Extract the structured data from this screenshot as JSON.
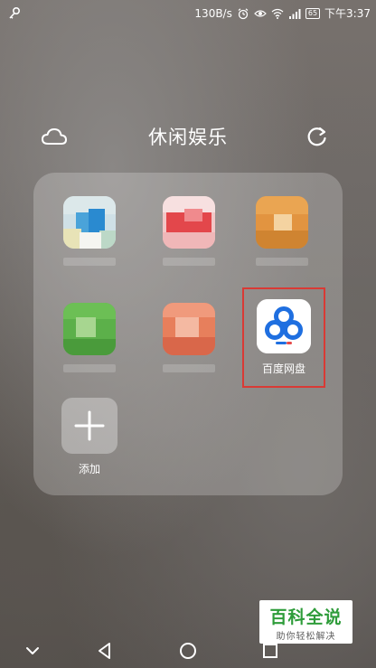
{
  "status_bar": {
    "network_speed": "130B/s",
    "battery_level": "65",
    "time": "下午3:37",
    "icons": [
      "key-icon",
      "alarm-icon",
      "eye-icon",
      "wifi-icon",
      "signal-icon",
      "battery-icon"
    ]
  },
  "folder": {
    "title": "休闲娱乐",
    "icons": {
      "left": "cloud-icon",
      "right": "refresh-icon"
    }
  },
  "apps": [
    {
      "label": "",
      "blurred": true
    },
    {
      "label": "",
      "blurred": true
    },
    {
      "label": "",
      "blurred": true
    },
    {
      "label": "",
      "blurred": true
    },
    {
      "label": "",
      "blurred": true
    },
    {
      "label": "百度网盘",
      "blurred": false,
      "highlighted": true,
      "highlight_color": "#d93a35"
    },
    {
      "label": "添加",
      "icon": "plus-icon"
    }
  ],
  "watermark": {
    "title": "百科全说",
    "subtitle": "助你轻松解决"
  },
  "nav_bar": {
    "icons": [
      "chevron-down-icon",
      "back-icon",
      "home-icon",
      "recents-icon"
    ]
  },
  "colors": {
    "highlight": "#d93a35",
    "watermark_green": "#2e9c3a",
    "baidu_blue": "#1f6fe0"
  }
}
